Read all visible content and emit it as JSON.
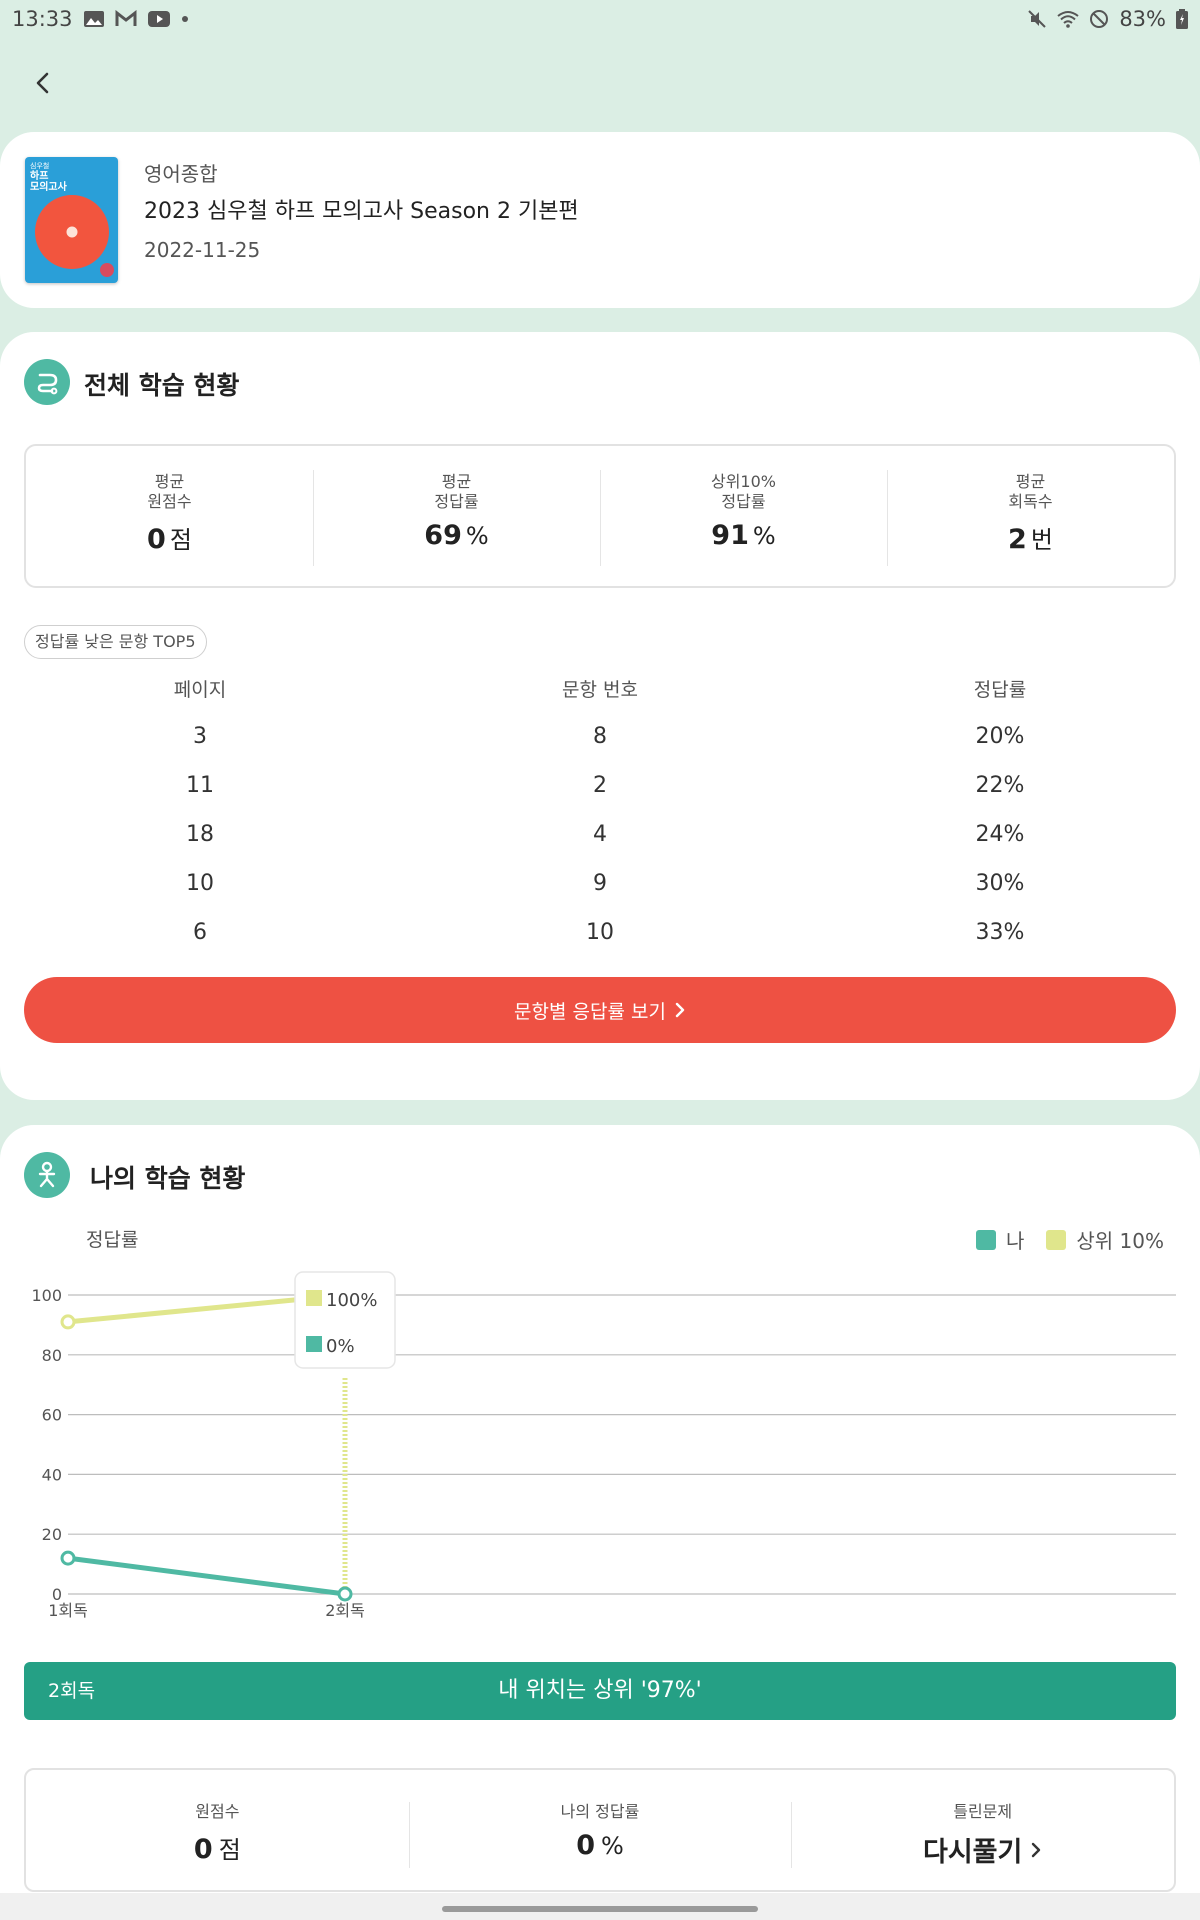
{
  "statusbar": {
    "time": "13:33",
    "battery": "83%"
  },
  "book": {
    "category": "영어종합",
    "title": "2023 심우철 하프 모의고사 Season 2 기본편",
    "date": "2022-11-25",
    "cover_line1": "심우철",
    "cover_line2": "하프",
    "cover_line3": "모의고사"
  },
  "overall": {
    "title": "전체 학습 현황",
    "stats": [
      {
        "label": "평균\n원점수",
        "value": "0",
        "unit": "점"
      },
      {
        "label": "평균\n정답률",
        "value": "69",
        "unit": "%"
      },
      {
        "label": "상위10%\n정답률",
        "value": "91",
        "unit": "%"
      },
      {
        "label": "평균\n회독수",
        "value": "2",
        "unit": "번"
      }
    ],
    "top5_label": "정답률 낮은 문항 TOP5",
    "columns": [
      "페이지",
      "문항 번호",
      "정답률"
    ],
    "rows": [
      [
        "3",
        "8",
        "20%"
      ],
      [
        "11",
        "2",
        "22%"
      ],
      [
        "18",
        "4",
        "24%"
      ],
      [
        "10",
        "9",
        "30%"
      ],
      [
        "6",
        "10",
        "33%"
      ]
    ],
    "button_label": "문항별 응답률 보기"
  },
  "mine": {
    "title": "나의 학습 현황",
    "tooltip": {
      "top_value": "100%",
      "me_value": "0%"
    },
    "position_round": "2회독",
    "position_text": "내 위치는 상위 '97%'",
    "bottom": [
      {
        "label": "원점수",
        "value": "0",
        "unit": "점"
      },
      {
        "label": "나의 정답률",
        "value": "0",
        "unit": "%"
      },
      {
        "label": "틀린문제",
        "link": "다시풀기"
      }
    ]
  },
  "chart_data": {
    "type": "line",
    "ylabel": "정답률",
    "categories": [
      "1회독",
      "2회독"
    ],
    "ylim": [
      0,
      100
    ],
    "yticks": [
      0,
      20,
      40,
      60,
      80,
      100
    ],
    "series": [
      {
        "name": "나",
        "values": [
          12,
          0
        ],
        "color": "#4fb9a3"
      },
      {
        "name": "상위 10%",
        "values": [
          91,
          100
        ],
        "color": "#e0e68c"
      }
    ],
    "legend": "top-right",
    "grid": true
  }
}
